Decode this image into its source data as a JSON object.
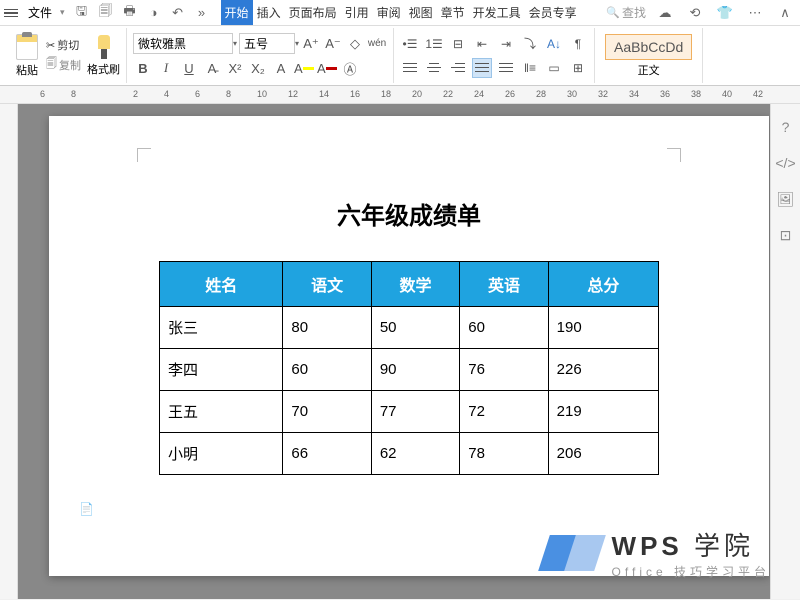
{
  "menu": {
    "file": "文件",
    "tabs": [
      "开始",
      "插入",
      "页面布局",
      "引用",
      "审阅",
      "视图",
      "章节",
      "开发工具",
      "会员专享"
    ],
    "active_tab": 0,
    "search_placeholder": "查找"
  },
  "ribbon": {
    "paste": "粘贴",
    "cut": "剪切",
    "copy": "复制",
    "format_painter": "格式刷",
    "font_name": "微软雅黑",
    "font_size": "五号",
    "style_sample": "AaBbCcDd",
    "style_name": "正文"
  },
  "ruler_ticks": [
    "6",
    "8",
    "",
    "2",
    "4",
    "6",
    "8",
    "10",
    "12",
    "14",
    "16",
    "18",
    "20",
    "22",
    "24",
    "26",
    "28",
    "30",
    "32",
    "34",
    "36",
    "38",
    "40",
    "42"
  ],
  "document": {
    "title": "六年级成绩单",
    "headers": [
      "姓名",
      "语文",
      "数学",
      "英语",
      "总分"
    ],
    "rows": [
      {
        "name": "张三",
        "chinese": "80",
        "math": "50",
        "english": "60",
        "total": "190"
      },
      {
        "name": "李四",
        "chinese": "60",
        "math": "90",
        "english": "76",
        "total": "226"
      },
      {
        "name": "王五",
        "chinese": "70",
        "math": "77",
        "english": "72",
        "total": "219"
      },
      {
        "name": "小明",
        "chinese": "66",
        "math": "62",
        "english": "78",
        "total": "206"
      }
    ]
  },
  "watermark": {
    "brand": "WPS",
    "suffix": "学院",
    "subtitle": "Office 技巧学习平台"
  }
}
